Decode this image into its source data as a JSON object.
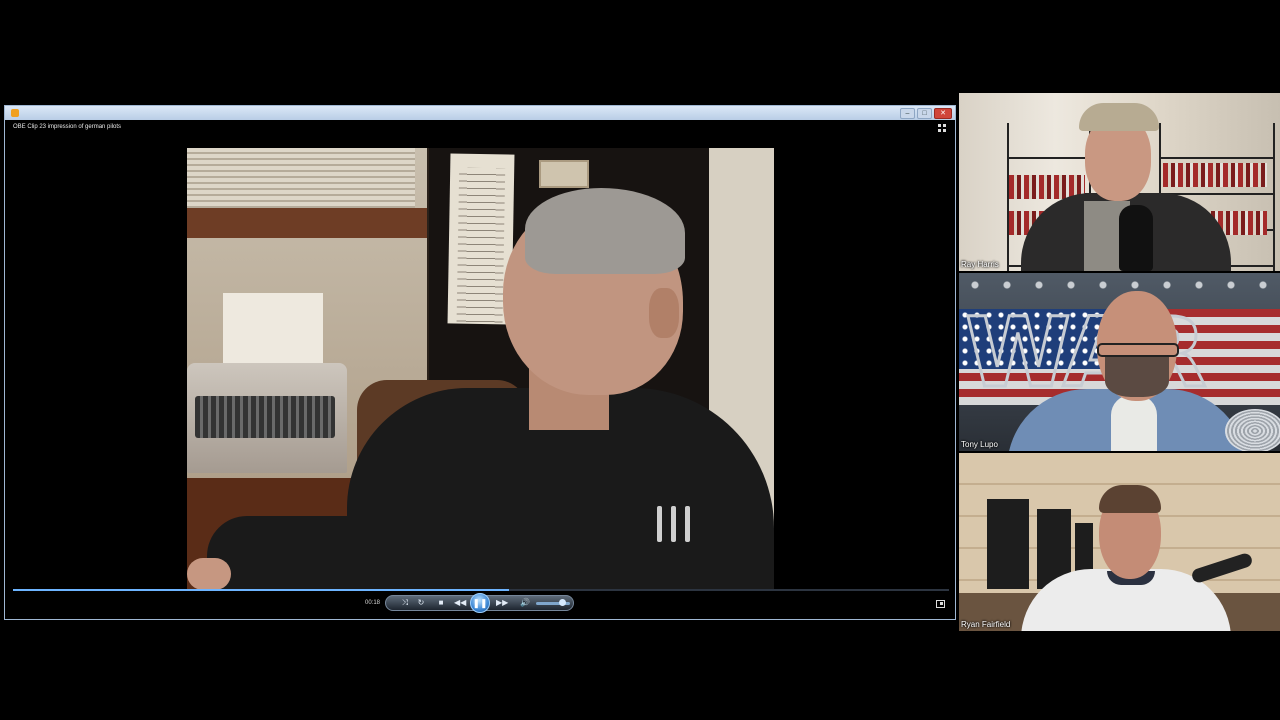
{
  "player": {
    "video_title": "OBE Clip 23 impression of german pilots",
    "window_buttons": {
      "minimize": "–",
      "maximize": "□",
      "close": "✕"
    },
    "time_elapsed": "00:18",
    "playback_progress": 0.53,
    "volume_level": 0.8,
    "state": "playing",
    "controls": {
      "shuffle_icon": "⤨",
      "repeat_icon": "↻",
      "stop_icon": "■",
      "previous_icon": "◀◀",
      "pause_icon": "❚❚",
      "next_icon": "▶▶",
      "mute_icon": "🔊"
    },
    "icons": [
      "app-icon",
      "switch-mode-icon",
      "fullscreen-icon"
    ]
  },
  "participants": [
    {
      "name": "Ray Harris"
    },
    {
      "name": "Tony Lupo"
    },
    {
      "name": "Ryan Fairfield"
    }
  ],
  "colors": {
    "background": "#000000",
    "titlebar": "#c6d7ec",
    "progress": "#6db4ff",
    "close_button": "#d0453a"
  }
}
